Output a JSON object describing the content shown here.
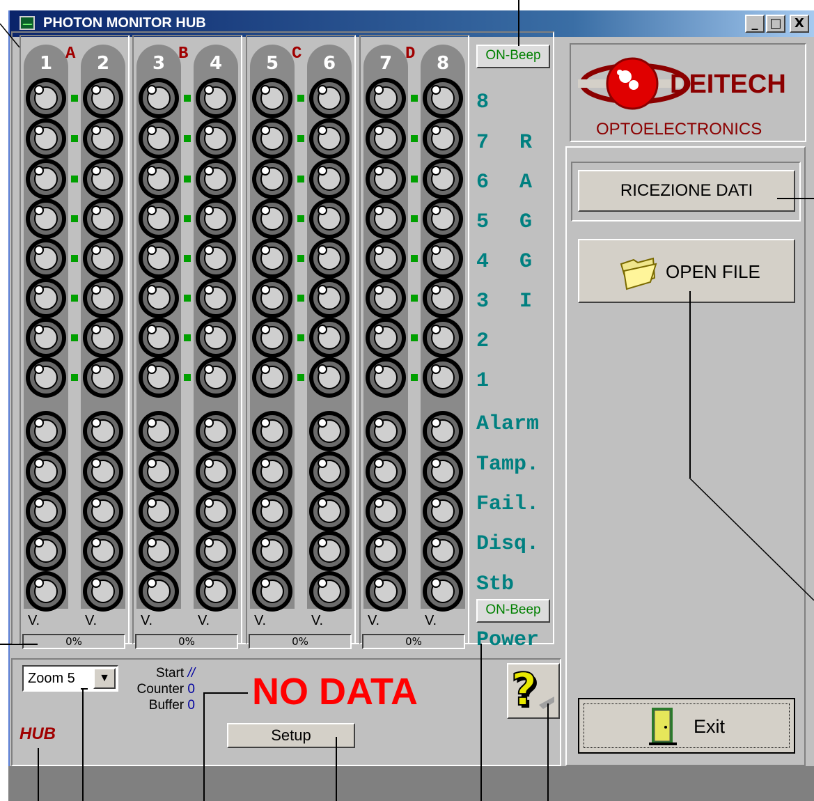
{
  "window": {
    "title": "PHOTON MONITOR HUB",
    "controls": [
      "_",
      "□",
      "X"
    ]
  },
  "groups": [
    {
      "letter": "A",
      "columns": [
        "1",
        "2"
      ],
      "progress": "0%"
    },
    {
      "letter": "B",
      "columns": [
        "3",
        "4"
      ],
      "progress": "0%"
    },
    {
      "letter": "C",
      "columns": [
        "5",
        "6"
      ],
      "progress": "0%"
    },
    {
      "letter": "D",
      "columns": [
        "7",
        "8"
      ],
      "progress": "0%"
    }
  ],
  "voltage_label": "V.",
  "beam_numbers": [
    "8",
    "7",
    "6",
    "5",
    "4",
    "3",
    "2",
    "1"
  ],
  "raggi_letters": [
    "R",
    "A",
    "G",
    "G",
    "I"
  ],
  "status_labels": [
    "Alarm",
    "Tamp.",
    "Fail.",
    "Disq.",
    "Stb"
  ],
  "power_label": "Power",
  "beep_top": "ON-Beep",
  "beep_bottom": "ON-Beep",
  "logo": {
    "brand": "DEITECH",
    "subtitle": "OPTOELECTRONICS",
    "eye_color": "#e00000",
    "brand_color": "#8b0000"
  },
  "buttons": {
    "ricezione": "RICEZIONE DATI",
    "open_file": "OPEN FILE",
    "exit": "Exit",
    "setup": "Setup"
  },
  "zoom": {
    "value": "Zoom 5"
  },
  "info": {
    "start_label": "Start",
    "start_value": "//",
    "counter_label": "Counter",
    "counter_value": "0",
    "buffer_label": "Buffer",
    "buffer_value": "0"
  },
  "no_data": "NO DATA",
  "hub_label": "HUB",
  "icons": {
    "help": "help-question-icon",
    "folder": "folder-icon",
    "door": "door-exit-icon"
  },
  "colors": {
    "teal": "#008080",
    "status_red": "#ff0000",
    "led_green": "#00a000"
  }
}
